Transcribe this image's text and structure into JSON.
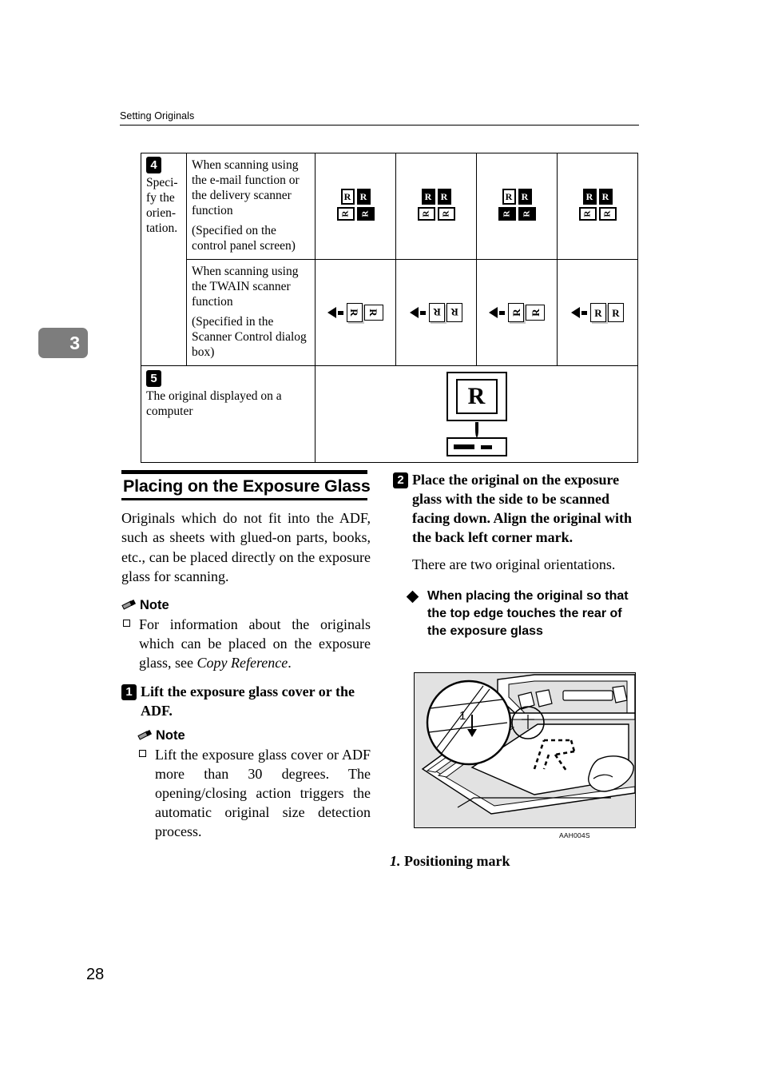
{
  "header": {
    "title": "Setting Originals"
  },
  "chapter_tab": {
    "number": "3"
  },
  "page_number": "28",
  "table": {
    "rows": [
      {
        "step_badge": "4",
        "step_label": "Speci-fy the orien-tation.",
        "desc_lines": [
          "When scanning using the e-mail function or the delivery scanner function",
          "(Specified on the control panel screen)"
        ],
        "cells": [
          {
            "glyphs": [
              "R",
              "R",
              "R",
              "R"
            ]
          },
          {
            "glyphs": [
              "R",
              "R",
              "R",
              "R"
            ]
          },
          {
            "glyphs": [
              "R",
              "R",
              "R",
              "R"
            ]
          },
          {
            "glyphs": [
              "R",
              "R",
              "R",
              "R"
            ]
          }
        ]
      },
      {
        "step_badge": "",
        "desc_lines": [
          "When scanning using the TWAIN scanner function",
          "(Specified in the Scanner Control dialog box)"
        ],
        "cells": [
          {
            "glyphs": [
              "R",
              "R"
            ]
          },
          {
            "glyphs": [
              "R",
              "R"
            ]
          },
          {
            "glyphs": [
              "R",
              "R"
            ]
          },
          {
            "glyphs": [
              "R",
              "R"
            ]
          }
        ]
      },
      {
        "step_badge": "5",
        "desc_lines": [
          "The original displayed on a computer"
        ],
        "monitor_glyph": "R"
      }
    ]
  },
  "left_column": {
    "section_title": "Placing on the Exposure Glass",
    "intro": "Originals which do not fit into the ADF, such as sheets with glued-on parts, books, etc., can be placed directly on the exposure glass for scanning.",
    "note1": {
      "label": "Note",
      "items": [
        {
          "text": "For information about the originals which can be placed on the exposure glass, see ",
          "italic": "Copy Reference",
          "tail": "."
        }
      ]
    },
    "step1": {
      "badge": "1",
      "text": "Lift the exposure glass cover or the ADF."
    },
    "note2": {
      "label": "Note",
      "items": [
        {
          "text": "Lift the exposure glass cover or ADF more than 30 degrees. The opening/closing action triggers the automatic original size detection process."
        }
      ]
    }
  },
  "right_column": {
    "step2": {
      "badge": "2",
      "text": "Place the original on the exposure glass with the side to be scanned facing down. Align the original with the back left corner mark."
    },
    "step2_body": "There are two original orientations.",
    "subsection": "When placing the original so that the top edge touches the rear of the exposure glass",
    "figure": {
      "code": "AAH004S",
      "callout": "1"
    },
    "figure_caption": {
      "number": "1.",
      "text": "Positioning mark"
    }
  }
}
